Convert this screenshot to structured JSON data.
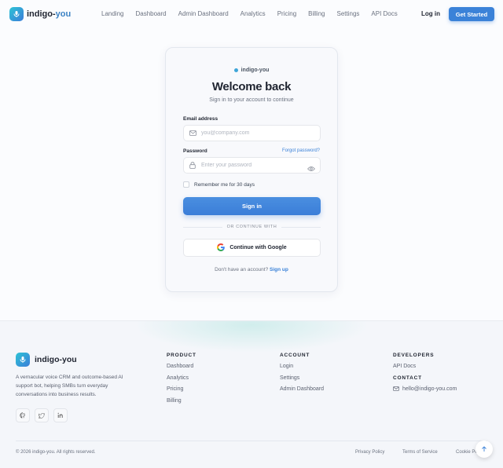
{
  "header": {
    "brand_name": "indigo-",
    "brand_accent": "you",
    "nav": [
      "Landing",
      "Dashboard",
      "Admin Dashboard",
      "Analytics",
      "Pricing",
      "Billing",
      "Settings",
      "API Docs"
    ],
    "login_label": "Log in",
    "cta_label": "Get Started"
  },
  "card": {
    "brand": "indigo-you",
    "title": "Welcome back",
    "subtitle": "Sign in to your account to continue",
    "email_label": "Email address",
    "email_placeholder": "you@company.com",
    "password_label": "Password",
    "forgot_label": "Forgot password?",
    "password_placeholder": "Enter your password",
    "remember_label": "Remember me for 30 days",
    "signin_label": "Sign in",
    "divider_label": "OR CONTINUE WITH",
    "google_label": "Continue with Google",
    "signup_prompt": "Don't have an account?",
    "signup_link": "Sign up"
  },
  "footer": {
    "brand": "indigo-you",
    "description": "A vernacular voice CRM and outcome-based AI support bot, helping SMBs turn everyday conversations into business results.",
    "product": {
      "title": "PRODUCT",
      "links": [
        "Dashboard",
        "Analytics",
        "Pricing",
        "Billing"
      ]
    },
    "account": {
      "title": "ACCOUNT",
      "links": [
        "Login",
        "Settings",
        "Admin Dashboard"
      ]
    },
    "developers": {
      "title": "DEVELOPERS",
      "links": [
        "API Docs"
      ]
    },
    "contact": {
      "title": "CONTACT",
      "email": "hello@indigo-you.com"
    },
    "copyright": "© 2026 indigo-you. All rights reserved.",
    "legal": [
      "Privacy Policy",
      "Terms of Service",
      "Cookie Policy"
    ]
  },
  "colors": {
    "accent": "#3b82d8",
    "brand_gradient_start": "#2ec4d6",
    "brand_gradient_end": "#3b7dd8"
  },
  "icons": [
    "mic-icon",
    "mail-icon",
    "lock-icon",
    "eye-icon",
    "google-icon",
    "github-icon",
    "twitter-icon",
    "linkedin-icon",
    "arrow-up-icon"
  ]
}
